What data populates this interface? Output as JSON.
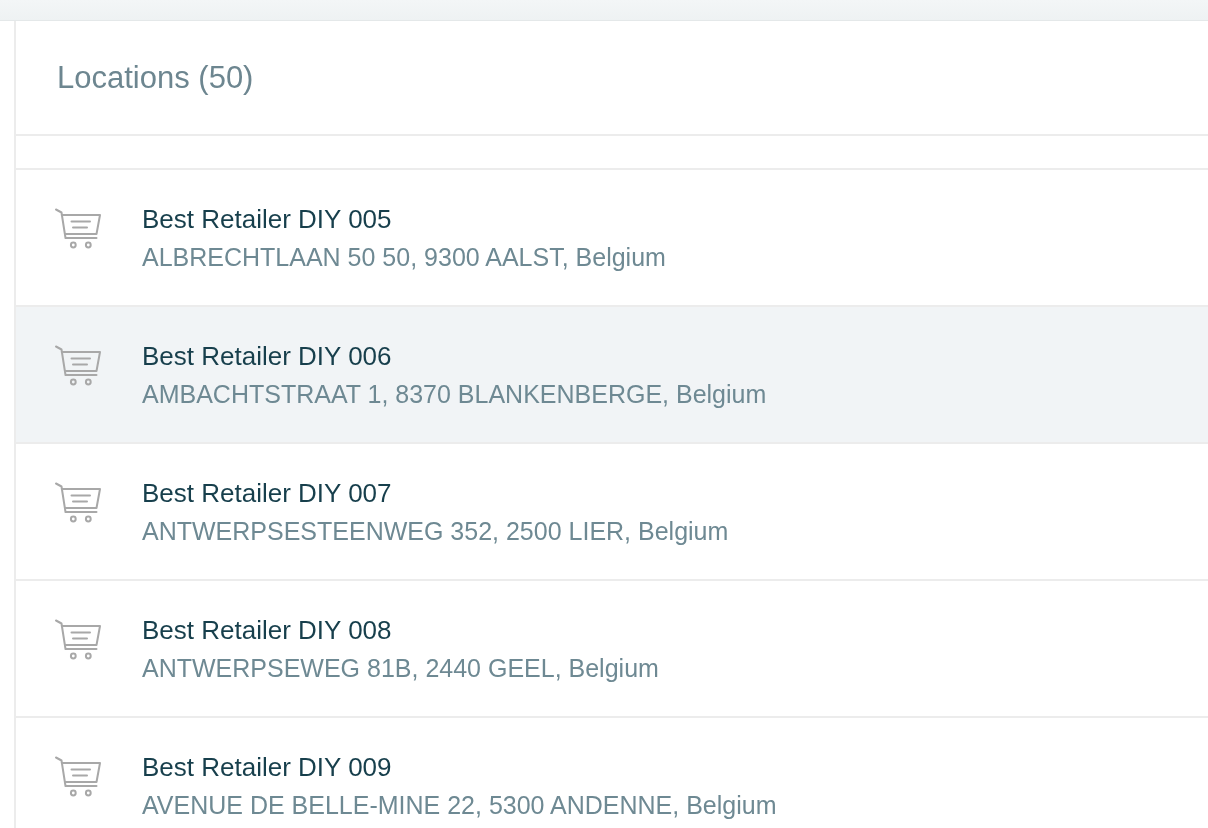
{
  "header": {
    "title": "Locations (50)"
  },
  "locations": [
    {
      "name": "Best Retailer DIY 005",
      "address": "ALBRECHTLAAN 50 50, 9300 AALST, Belgium",
      "selected": false
    },
    {
      "name": "Best Retailer DIY 006",
      "address": "AMBACHTSTRAAT 1, 8370 BLANKENBERGE, Belgium",
      "selected": true
    },
    {
      "name": "Best Retailer DIY 007",
      "address": "ANTWERPSESTEENWEG 352, 2500 LIER, Belgium",
      "selected": false
    },
    {
      "name": "Best Retailer DIY 008",
      "address": "ANTWERPSEWEG 81B, 2440 GEEL, Belgium",
      "selected": false
    },
    {
      "name": "Best Retailer DIY 009",
      "address": "AVENUE DE BELLE-MINE 22, 5300 ANDENNE, Belgium",
      "selected": false
    }
  ]
}
